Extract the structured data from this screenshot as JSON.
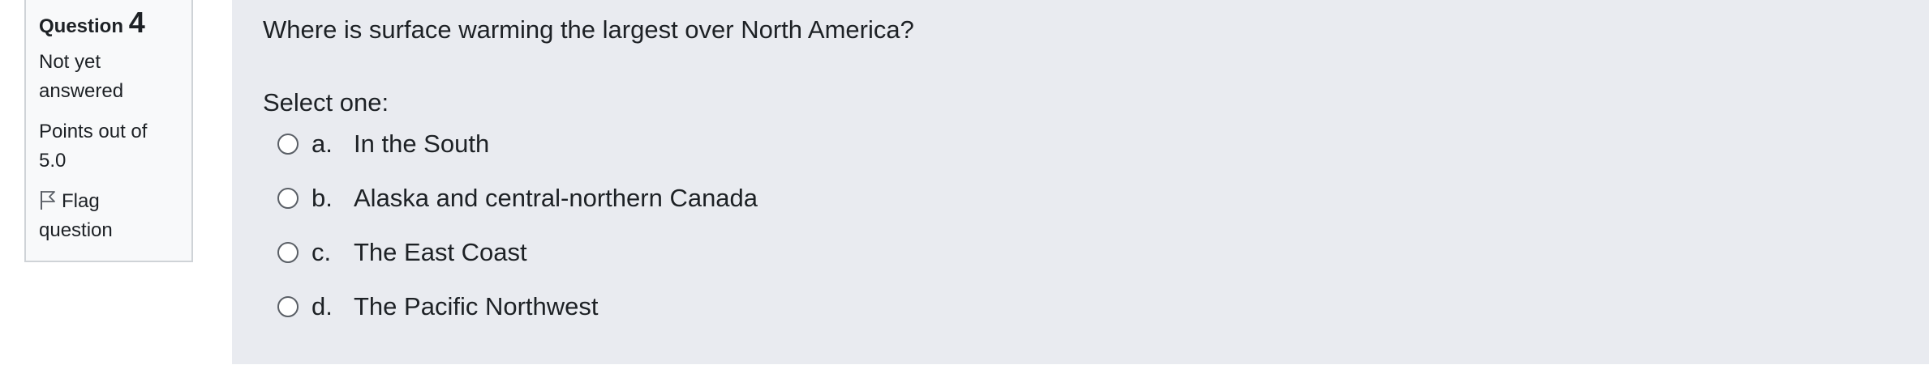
{
  "info": {
    "question_label": "Question",
    "question_number": "4",
    "status_line1": "Not yet",
    "status_line2": "answered",
    "points_line1": "Points out of",
    "points_line2": "5.0",
    "flag_line1": "Flag",
    "flag_line2": "question",
    "flag_icon": "flag-icon"
  },
  "question": {
    "text": "Where is surface warming the largest over North America?",
    "prompt": "Select one:",
    "answers": [
      {
        "letter": "a.",
        "text": "In the South",
        "selected": false
      },
      {
        "letter": "b.",
        "text": "Alaska and central-northern Canada",
        "selected": false
      },
      {
        "letter": "c.",
        "text": "The East Coast",
        "selected": false
      },
      {
        "letter": "d.",
        "text": "The Pacific Northwest",
        "selected": false
      }
    ]
  },
  "colors": {
    "info_background": "#f8f9fa",
    "content_background": "#e9ebf0",
    "text": "#1d2125",
    "border": "#cfd3d7"
  }
}
